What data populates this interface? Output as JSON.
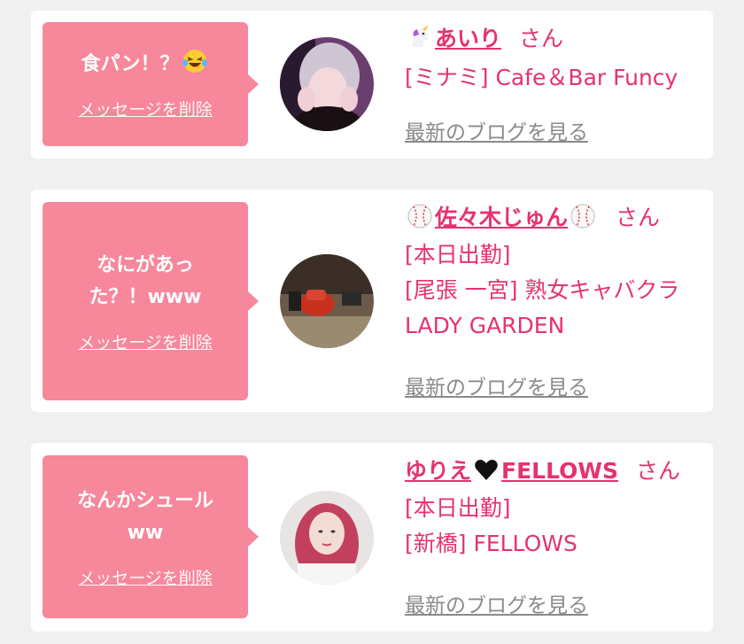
{
  "cards": [
    {
      "message": "食パン！？",
      "message_emoji": "laughing-tears-emoji",
      "delete_label": "メッセージを削除",
      "name_prefix_emoji": "unicorn-emoji",
      "name": "あいり",
      "name_suffix_emoji": "",
      "san": "さん",
      "lines": [
        "[ミナミ] Cafe＆Bar Funcy"
      ],
      "blog_label": "最新のブログを見る"
    },
    {
      "message": "なにがあった？！www",
      "delete_label": "メッセージを削除",
      "name_prefix_emoji": "baseball-emoji",
      "name": "佐々木じゅん",
      "name_suffix_emoji": "baseball-emoji",
      "san": "さん",
      "lines": [
        "[本日出勤]",
        "[尾張 一宮] 熟女キャバクラ LADY GARDEN"
      ],
      "blog_label": "最新のブログを見る"
    },
    {
      "message": "なんかシュールww",
      "delete_label": "メッセージを削除",
      "name_prefix_emoji": "",
      "name_part1": "ゆりえ",
      "name_mid_emoji": "black-heart-emoji",
      "name_part2": "FELLOWS",
      "san": "さん",
      "lines": [
        "[本日出勤]",
        "[新橋] FELLOWS"
      ],
      "blog_label": "最新のブログを見る"
    }
  ],
  "colors": {
    "accent_pink": "#e5336d",
    "bubble_pink": "#f7879b",
    "page_bg": "#f0f0f0"
  }
}
